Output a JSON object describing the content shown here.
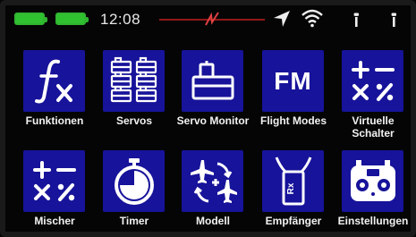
{
  "status": {
    "time": "12:08",
    "battery_color": "#2fc12f",
    "signal_line_color": "#c21f1f"
  },
  "tiles": [
    {
      "id": "funktionen",
      "label": "Funktionen",
      "icon": "fx-icon"
    },
    {
      "id": "servos",
      "label": "Servos",
      "icon": "servos-icon"
    },
    {
      "id": "servo_monitor",
      "label": "Servo Monitor",
      "icon": "servo-monitor-icon"
    },
    {
      "id": "flight_modes",
      "label": "Flight Modes",
      "icon": "fm-icon",
      "glyph": "FM"
    },
    {
      "id": "virtuelle_schalter",
      "label_line1": "Virtuelle",
      "label_line2": "Schalter",
      "icon": "math-ops-icon"
    },
    {
      "id": "mischer",
      "label": "Mischer",
      "icon": "math-ops-icon"
    },
    {
      "id": "timer",
      "label": "Timer",
      "icon": "stopwatch-icon"
    },
    {
      "id": "modell",
      "label": "Modell",
      "icon": "aircraft-model-icon"
    },
    {
      "id": "empfaenger",
      "label": "Empfänger",
      "icon": "receiver-icon",
      "glyph": "Rx"
    },
    {
      "id": "einstellungen",
      "label": "Einstellungen",
      "icon": "transmitter-icon"
    }
  ],
  "colors": {
    "tile_bg": "#17139a",
    "label_text": "#f2f2f2",
    "screen_bg": "#050505"
  }
}
